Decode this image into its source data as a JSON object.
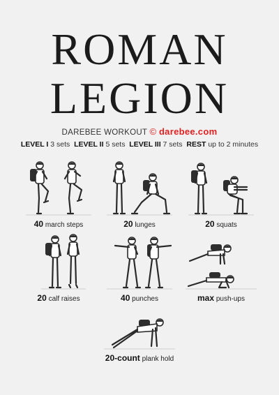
{
  "title": {
    "line1": "ROMAN",
    "line2": "LEGION"
  },
  "subtitle": {
    "label": "DAREBEE WORKOUT",
    "copyright": "©",
    "brand": "darebee.com"
  },
  "levels": [
    {
      "name": "LEVEL I",
      "value": "3 sets"
    },
    {
      "name": "LEVEL II",
      "value": "5 sets"
    },
    {
      "name": "LEVEL III",
      "value": "7 sets"
    },
    {
      "name": "REST",
      "value": "up to 2 minutes"
    }
  ],
  "exercises": [
    {
      "count": "40",
      "name": "march steps",
      "icon": "march-steps-figure"
    },
    {
      "count": "20",
      "name": "lunges",
      "icon": "lunges-figure"
    },
    {
      "count": "20",
      "name": "squats",
      "icon": "squats-figure"
    },
    {
      "count": "20",
      "name": "calf raises",
      "icon": "calf-raises-figure"
    },
    {
      "count": "40",
      "name": "punches",
      "icon": "punches-figure"
    },
    {
      "count": "max",
      "name": "push-ups",
      "icon": "push-ups-figure"
    },
    {
      "count": "20-count",
      "name": "plank hold",
      "icon": "plank-hold-figure"
    }
  ]
}
